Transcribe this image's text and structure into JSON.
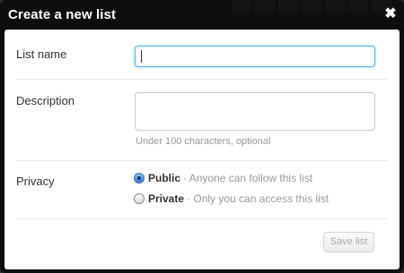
{
  "dialog": {
    "title": "Create a new list",
    "close_glyph": "✖"
  },
  "form": {
    "name_label": "List name",
    "name_value": "",
    "description_label": "Description",
    "description_value": "",
    "description_hint": "Under 100 characters, optional",
    "privacy_label": "Privacy",
    "privacy_options": [
      {
        "title": "Public",
        "description": "· Anyone can follow this list",
        "selected": true
      },
      {
        "title": "Private",
        "description": "· Only you can access this list",
        "selected": false
      }
    ],
    "save_label": "Save list"
  },
  "colors": {
    "header_bg": "#0a0a0a",
    "focus_border": "#56b4ef",
    "muted_text": "#999999"
  },
  "icons": {
    "close": "close-icon",
    "radio_selected": "radio-checked-icon",
    "radio_unselected": "radio-unchecked-icon"
  }
}
